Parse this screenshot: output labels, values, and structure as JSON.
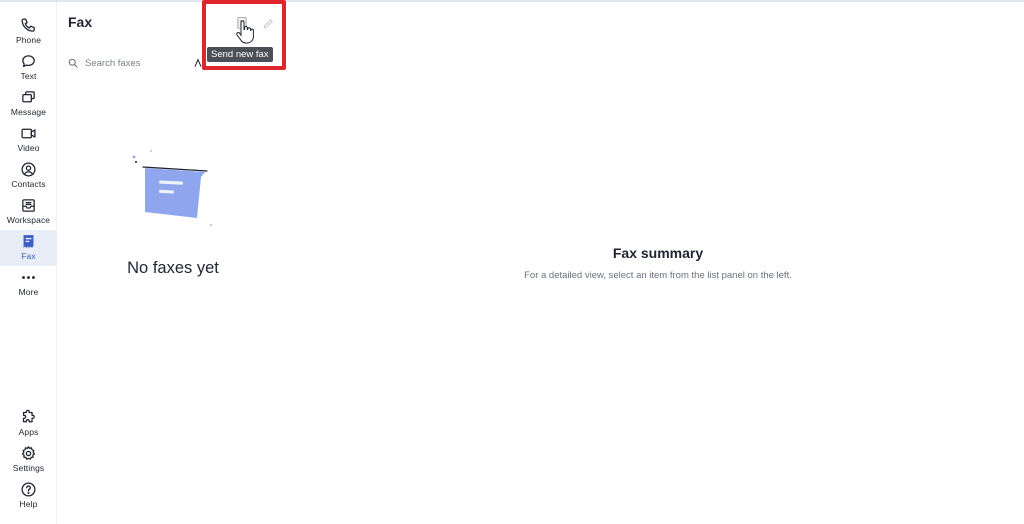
{
  "nav": {
    "items": [
      {
        "label": "Phone",
        "icon": "phone-icon"
      },
      {
        "label": "Text",
        "icon": "chat-bubble-icon"
      },
      {
        "label": "Message",
        "icon": "messages-icon"
      },
      {
        "label": "Video",
        "icon": "video-camera-icon"
      },
      {
        "label": "Contacts",
        "icon": "contact-person-icon"
      },
      {
        "label": "Workspace",
        "icon": "inbox-tray-icon"
      },
      {
        "label": "Fax",
        "icon": "fax-document-icon",
        "active": true
      },
      {
        "label": "More",
        "icon": "more-dots-icon"
      }
    ],
    "bottom": [
      {
        "label": "Apps",
        "icon": "puzzle-icon"
      },
      {
        "label": "Settings",
        "icon": "gear-icon"
      },
      {
        "label": "Help",
        "icon": "help-question-icon"
      }
    ]
  },
  "list_panel": {
    "title": "Fax",
    "tooltip": "Send new fax",
    "search_placeholder": "Search faxes",
    "empty_text": "No faxes yet"
  },
  "detail": {
    "title": "Fax summary",
    "subtitle": "For a detailed view, select an item from the list panel on the left."
  },
  "colors": {
    "accent": "#3d5fc4",
    "active_bg": "#e8edf7",
    "illustration": "#8fa6ee",
    "highlight": "#e0262d"
  }
}
